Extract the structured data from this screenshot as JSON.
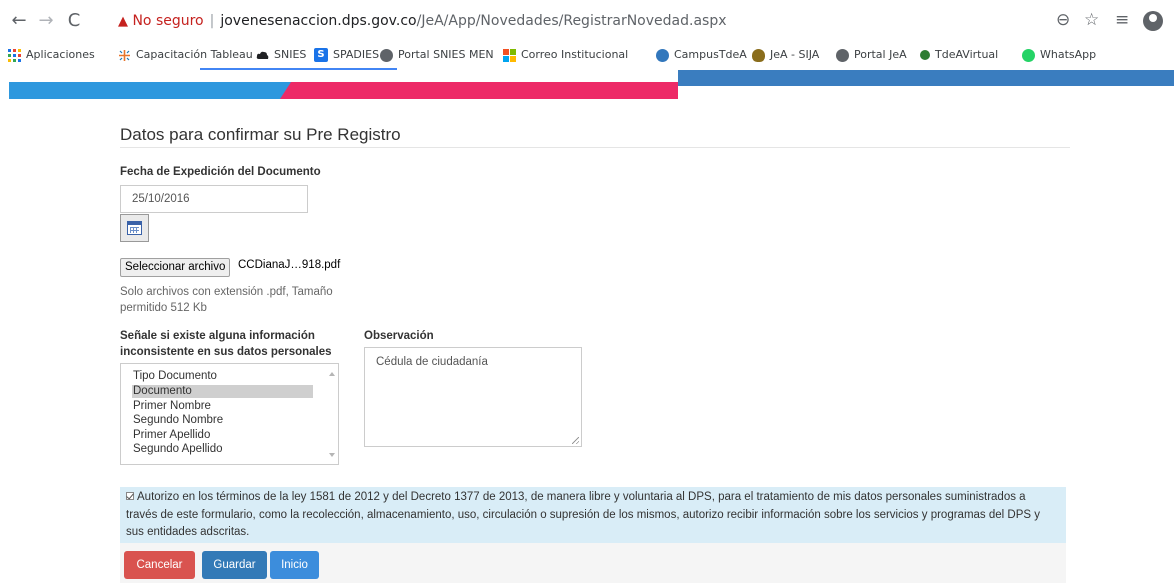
{
  "browser": {
    "security_icon": "warning-triangle-icon",
    "security_text": "No seguro",
    "separator": "|",
    "url_host": "jovenesenaccion.dps.gov.co",
    "url_path": "/JeA/App/Novedades/RegistrarNovedad.aspx",
    "nav_icons": [
      "back-arrow-icon",
      "forward-arrow-icon",
      "reload-icon"
    ],
    "right_icons": [
      "zoom-icon",
      "star-icon",
      "reading-list-icon",
      "profile-icon"
    ]
  },
  "bookmarks": [
    {
      "label": "Aplicaciones",
      "icon": "apps-grid-icon",
      "color": "#1a73e8"
    },
    {
      "label": "Capacitación Tableau",
      "icon": "tableau-icon",
      "color": "#e8762d"
    },
    {
      "label": "SNIES",
      "icon": "cloud-icon",
      "color": "#202124"
    },
    {
      "label": "SPADIES",
      "icon": "s-logo-icon",
      "color": "#1a73e8"
    },
    {
      "label": "Portal SNIES MEN",
      "icon": "globe-icon",
      "color": "#5f6368"
    },
    {
      "label": "Correo Institucional",
      "icon": "microsoft-icon",
      "color": "#f25022"
    },
    {
      "label": "CampusTdeA",
      "icon": "edge-icon",
      "color": "#3277bc"
    },
    {
      "label": "JeA - SIJA",
      "icon": "jea-logo-icon",
      "color": "#8a6d1c"
    },
    {
      "label": "Portal JeA",
      "icon": "globe-icon",
      "color": "#5f6368"
    },
    {
      "label": "TdeAVirtual",
      "icon": "circle-icon",
      "color": "#2e7d32"
    },
    {
      "label": "WhatsApp",
      "icon": "whatsapp-icon",
      "color": "#25d366"
    }
  ],
  "form": {
    "title": "Datos para confirmar su Pre Registro",
    "date_label": "Fecha de Expedición del Documento",
    "date_value": "25/10/2016",
    "file_button": "Seleccionar archivo",
    "file_name": "CCDianaJ…918.pdf",
    "file_help": "Solo archivos con extensión .pdf, Tamaño permitido 512 Kb",
    "inconsistency_label": "Señale si existe alguna información inconsistente en sus datos personales",
    "inconsistency_options": [
      "Tipo Documento",
      "Documento",
      "Primer Nombre",
      "Segundo Nombre",
      "Primer Apellido",
      "Segundo Apellido"
    ],
    "inconsistency_selected": "Documento",
    "observation_label": "Observación",
    "observation_value": "Cédula de ciudadanía",
    "consent_checked": true,
    "consent_text": "Autorizo en los términos de la ley 1581 de 2012 y del Decreto 1377 de 2013, de manera libre y voluntaria al DPS, para el tratamiento de mis datos personales suministrados a través de este formulario, como la recolección, almacenamiento, uso, circulación o supresión de los mismos, autorizo recibir información sobre los servicios y programas del DPS y sus entidades adscritas.",
    "buttons": {
      "cancel": "Cancelar",
      "save": "Guardar",
      "home": "Inicio"
    }
  },
  "colors": {
    "banner_blue": "#2e98de",
    "banner_pink": "#ed2a67",
    "cancel": "#d9534f",
    "save": "#337ab7",
    "consent_bg": "#d9edf7"
  }
}
